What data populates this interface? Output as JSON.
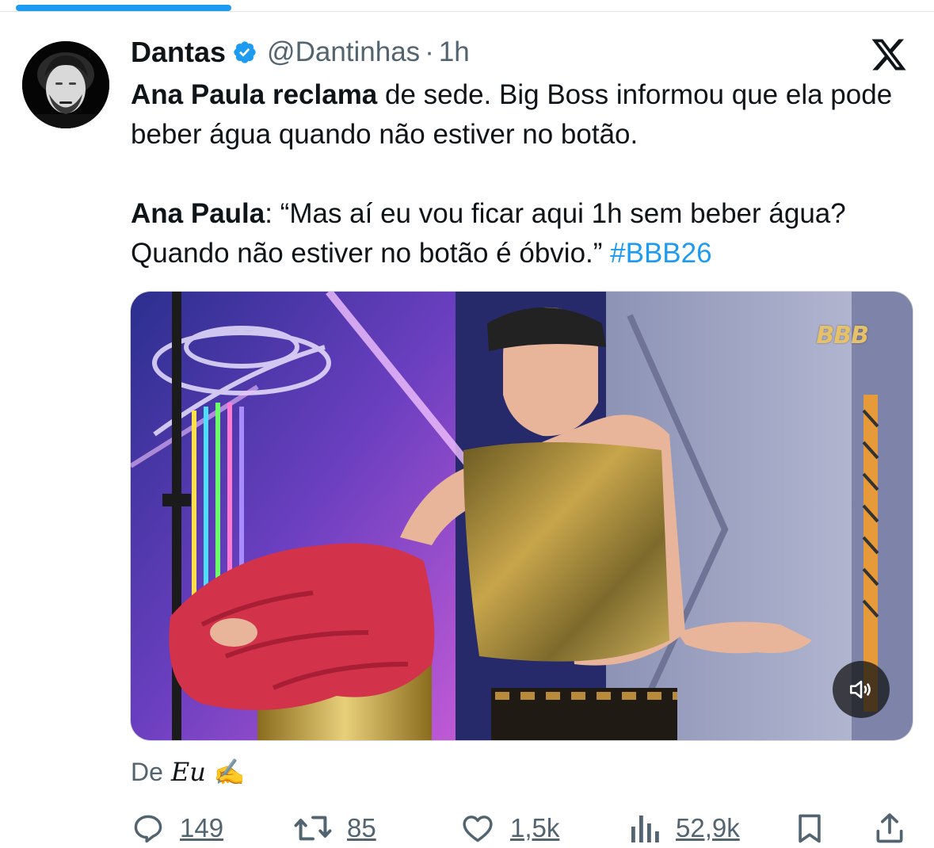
{
  "tweet": {
    "author_name": "Dantas",
    "handle": "@Dantinhas",
    "separator": "·",
    "time": "1h",
    "para1_bold": "Ana Paula reclama",
    "para1_rest": " de sede. Big Boss informou que ela pode beber água quando não estiver no botão.",
    "para2_bold": "Ana Paula",
    "para2_rest": ": “Mas aí eu vou ficar aqui 1h sem beber água? Quando não estiver no botão é óbvio.” ",
    "hashtag": "#BBB26"
  },
  "media": {
    "watermark": "BBB"
  },
  "via": {
    "prefix": "De",
    "source": "Eu",
    "emoji": "✍️"
  },
  "actions": {
    "replies": "149",
    "reposts": "85",
    "likes": "1,5k",
    "views": "52,9k"
  },
  "colors": {
    "accent": "#1d9bf0",
    "muted_text": "#536471",
    "text": "#0f1419"
  },
  "icons": [
    "verified-badge-icon",
    "x-logo-icon",
    "volume-icon",
    "reply-icon",
    "repost-icon",
    "like-icon",
    "views-icon",
    "bookmark-icon",
    "share-icon"
  ]
}
